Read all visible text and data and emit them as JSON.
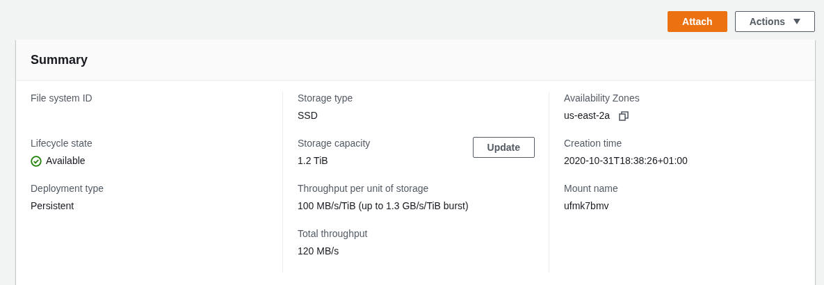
{
  "header_buttons": [
    {
      "label": "Attach",
      "kind": "primary"
    },
    {
      "label": "Actions",
      "kind": "dropdown"
    }
  ],
  "summary": {
    "title": "Summary",
    "columns": [
      {
        "fields": [
          {
            "label": "File system ID",
            "kind": "empty"
          },
          {
            "label": "Lifecycle state",
            "value": "Available",
            "kind": "status"
          },
          {
            "label": "Deployment type",
            "value": "Persistent",
            "kind": "text"
          }
        ]
      },
      {
        "fields": [
          {
            "label": "Storage type",
            "value": "SSD",
            "kind": "text"
          },
          {
            "label": "Storage capacity",
            "value": "1.2 TiB",
            "kind": "text",
            "button": "Update"
          },
          {
            "label": "Throughput per unit of storage",
            "value": "100 MB/s/TiB (up to 1.3 GB/s/TiB burst)",
            "kind": "text"
          },
          {
            "label": "Total throughput",
            "value": "120 MB/s",
            "kind": "text"
          }
        ]
      },
      {
        "fields": [
          {
            "label": "Availability Zones",
            "value": "us-east-2a",
            "kind": "copy"
          },
          {
            "label": "Creation time",
            "value": "2020-10-31T18:38:26+01:00",
            "kind": "text"
          },
          {
            "label": "Mount name",
            "value": "ufmk7bmv",
            "kind": "text"
          }
        ]
      }
    ]
  }
}
